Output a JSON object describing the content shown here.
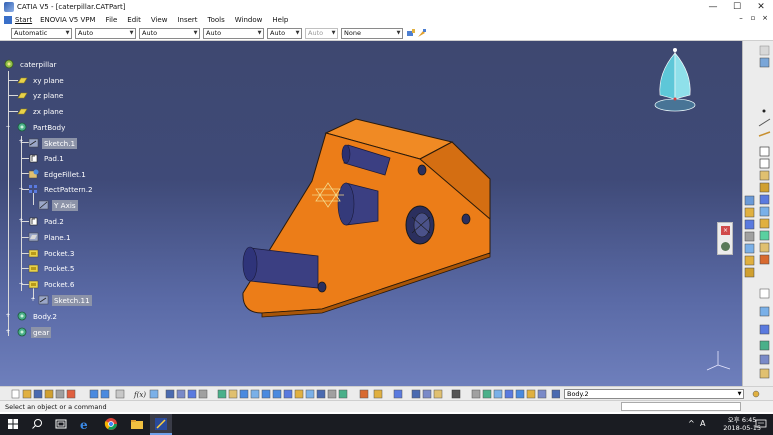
{
  "window": {
    "title": "CATIA V5 - [caterpillar.CATPart]",
    "controls": [
      "—",
      "☐",
      "✕"
    ]
  },
  "menu": {
    "items": [
      "Start",
      "ENOVIA V5 VPM",
      "File",
      "Edit",
      "View",
      "Insert",
      "Tools",
      "Window",
      "Help"
    ],
    "doc_controls": [
      "–",
      "▫",
      "×"
    ]
  },
  "property_toolbar": {
    "combo1": "Automatic",
    "combo2": "Auto",
    "combo3": "Auto",
    "combo4": "Auto",
    "combo5": "Auto",
    "combo6": "Auto",
    "combo7": "None"
  },
  "tree": {
    "root": "caterpillar",
    "nodes": [
      "xy plane",
      "yz plane",
      "zx plane",
      "PartBody",
      "Sketch.1",
      "Pad.1",
      "EdgeFillet.1",
      "RectPattern.2",
      "Y Axis",
      "Pad.2",
      "Plane.1",
      "Pocket.3",
      "Pocket.5",
      "Pocket.6",
      "Sketch.11",
      "Body.2",
      "gear"
    ]
  },
  "bottom_toolbar": {
    "current_body": "Body.2"
  },
  "status": {
    "message": "Select an object or a command"
  },
  "taskbar": {
    "time": "오후 6:45",
    "date": "2018-05-15",
    "lang": "A"
  },
  "colors": {
    "part_face": "#e8801c",
    "part_dark": "#b85a0a",
    "cylinder": "#3b3f82",
    "background_top": "#3e4870",
    "background_bottom": "#6e7fbc",
    "tree_highlight": "#8c93a8"
  }
}
